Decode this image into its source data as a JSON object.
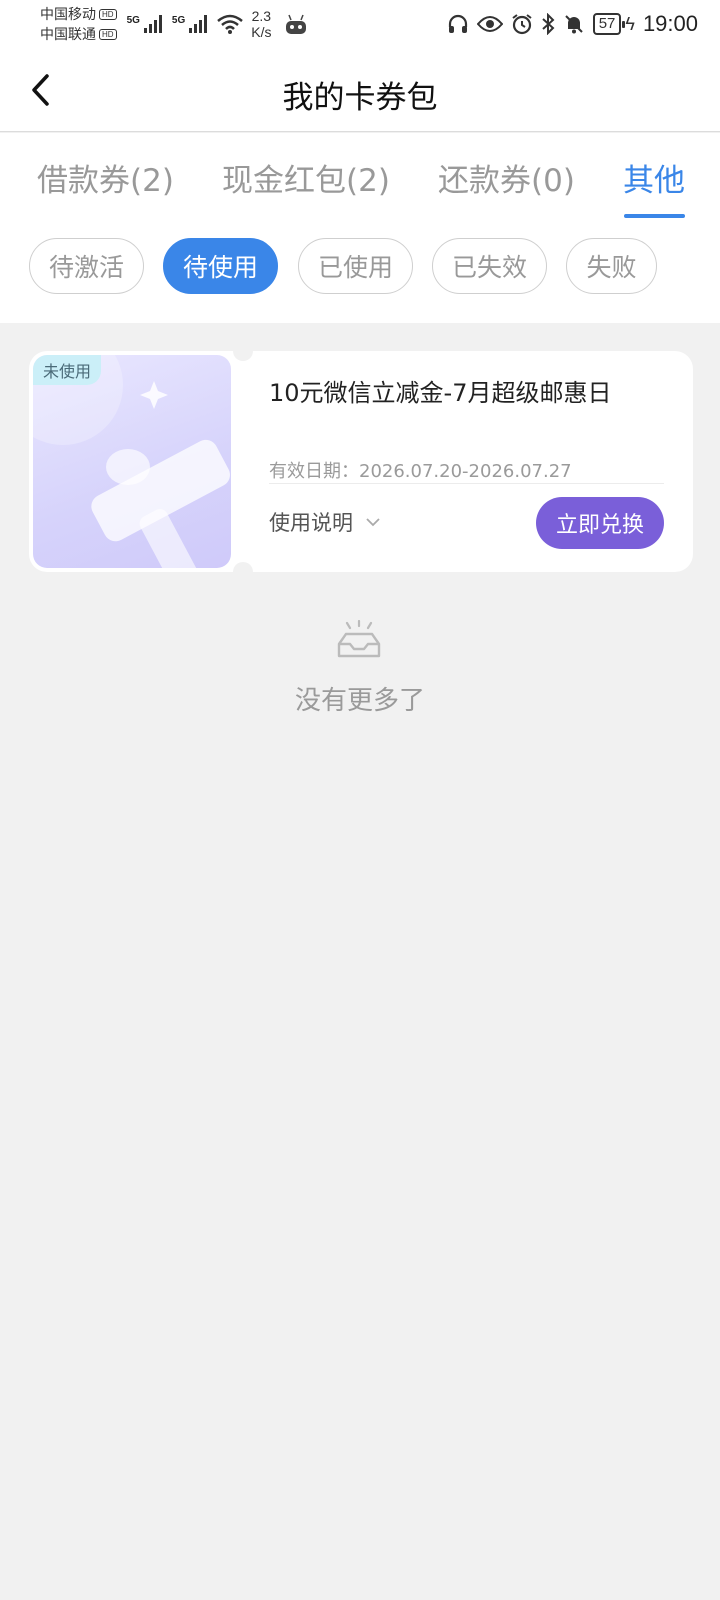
{
  "status_bar": {
    "carrier1": "中国移动",
    "carrier2": "中国联通",
    "hd_label": "HD",
    "net1": "5G",
    "net2": "5G",
    "speed_value": "2.3",
    "speed_unit": "K/s",
    "battery": "57",
    "time": "19:00"
  },
  "header": {
    "title": "我的卡券包",
    "back_icon": "chevron-left-icon"
  },
  "tabs": [
    {
      "label": "借款券(2)",
      "active": false
    },
    {
      "label": "现金红包(2)",
      "active": false
    },
    {
      "label": "还款券(0)",
      "active": false
    },
    {
      "label": "其他",
      "active": true
    }
  ],
  "filters": [
    {
      "label": "待激活",
      "active": false
    },
    {
      "label": "待使用",
      "active": true
    },
    {
      "label": "已使用",
      "active": false
    },
    {
      "label": "已失效",
      "active": false
    },
    {
      "label": "失败",
      "active": false
    }
  ],
  "coupon": {
    "badge": "未使用",
    "title": "10元微信立减金-7月超级邮惠日",
    "validity_label": "有效日期：",
    "validity_range": "2026.07.20-2026.07.27",
    "usage_label": "使用说明",
    "redeem_label": "立即兑换"
  },
  "empty": {
    "text": "没有更多了",
    "icon": "empty-tray-icon"
  },
  "colors": {
    "accent": "#3a86e8",
    "redeem": "#7a5fd9",
    "badge_bg": "#cbeff8",
    "background": "#f1f1f1"
  }
}
